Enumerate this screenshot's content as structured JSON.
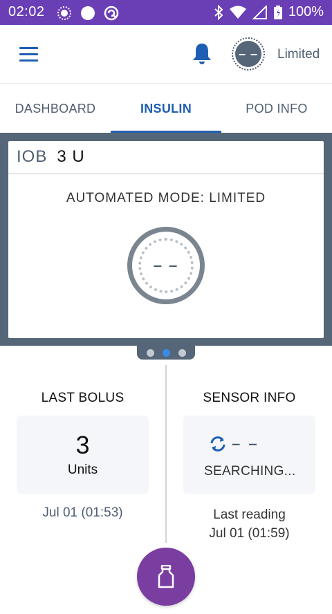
{
  "status_bar": {
    "time": "02:02",
    "battery": "100%",
    "bg_color": "#6a3fb6"
  },
  "app_bar": {
    "status_indicator": "– –",
    "mode_label": "Limited"
  },
  "tabs": [
    {
      "label": "DASHBOARD",
      "active": false
    },
    {
      "label": "INSULIN",
      "active": true
    },
    {
      "label": "POD INFO",
      "active": false
    }
  ],
  "iob_card": {
    "label": "IOB",
    "value": "3 U",
    "automated_mode": "AUTOMATED MODE: LIMITED",
    "gauge_value": "– –"
  },
  "pager": {
    "page_count": 3,
    "active_index": 1
  },
  "last_bolus": {
    "title": "LAST BOLUS",
    "value": "3",
    "unit": "Units",
    "time": "Jul 01 (01:53)"
  },
  "sensor_info": {
    "title": "SENSOR INFO",
    "value": "– –",
    "status": "SEARCHING...",
    "last_reading_label": "Last reading",
    "last_reading_time": "Jul 01 (01:59)"
  },
  "colors": {
    "accent": "#1f5fb3",
    "slate": "#566679",
    "fab": "#7a3ea1"
  },
  "icons": {
    "menu": "hamburger-menu-icon",
    "notifications": "bell-icon",
    "sensor": "sync-icon",
    "fab": "insulin-vial-icon"
  }
}
